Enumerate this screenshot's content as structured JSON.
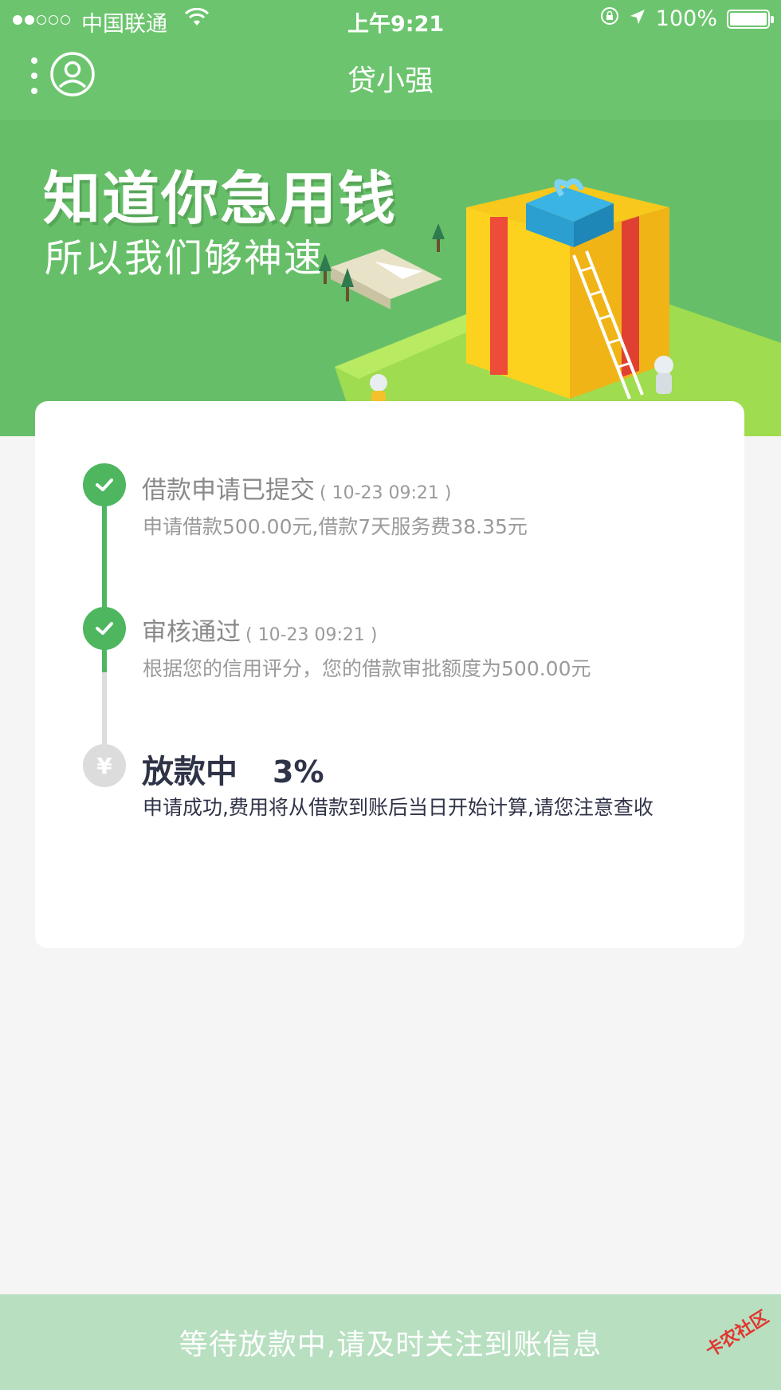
{
  "status_bar": {
    "carrier": "中国联通",
    "time": "上午9:21",
    "battery": "100%",
    "signal_strength": 2
  },
  "navbar": {
    "title": "贷小强"
  },
  "banner": {
    "title": "知道你急用钱",
    "subtitle": "所以我们够神速"
  },
  "timeline": [
    {
      "title": "借款申请已提交",
      "time": "( 10-23 09:21 )",
      "desc": "申请借款500.00元,借款7天服务费38.35元",
      "status": "done"
    },
    {
      "title": "审核通过",
      "time": "( 10-23 09:21 )",
      "desc": "根据您的信用评分，您的借款审批额度为500.00元",
      "status": "done"
    },
    {
      "title": "放款中",
      "progress": "3%",
      "desc": "申请成功,费用将从借款到账后当日开始计算,请您注意查收",
      "status": "pending",
      "icon_glyph": "¥"
    }
  ],
  "bottom_bar": {
    "label": "等待放款中,请及时关注到账信息"
  },
  "watermark": "卡农社区",
  "colors": {
    "primary_green": "#6cc56e",
    "node_green": "#4db65f",
    "bottom_bar": "#b7dfc0",
    "text_dark": "#2f3347"
  }
}
